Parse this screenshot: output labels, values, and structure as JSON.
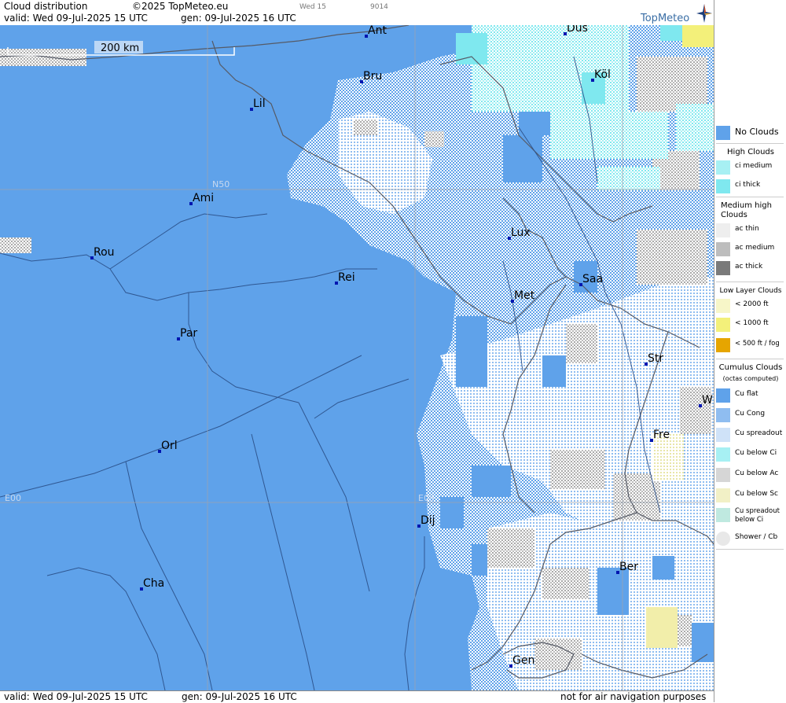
{
  "header": {
    "title": "Cloud distribution",
    "copyright": "©2025 TopMeteo.eu",
    "timestep": "Wed 15",
    "code": "9014",
    "valid": "valid:  Wed  09-Jul-2025  15 UTC",
    "generated": "gen: 09-Jul-2025 16 UTC",
    "logo": "TopMeteo"
  },
  "map": {
    "scale_label": "200 km",
    "grid_labels": {
      "lat_n50": "N50",
      "lon_e00": "E00",
      "lon_e05": "E05"
    },
    "cities": [
      {
        "id": "ant",
        "name": "Ant"
      },
      {
        "id": "dus",
        "name": "Düs"
      },
      {
        "id": "bru",
        "name": "Bru"
      },
      {
        "id": "kol",
        "name": "Köl"
      },
      {
        "id": "lil",
        "name": "Lil"
      },
      {
        "id": "ami",
        "name": "Ami"
      },
      {
        "id": "lux",
        "name": "Lux"
      },
      {
        "id": "rou",
        "name": "Rou"
      },
      {
        "id": "rei",
        "name": "Rei"
      },
      {
        "id": "saa",
        "name": "Saa"
      },
      {
        "id": "met",
        "name": "Met"
      },
      {
        "id": "par",
        "name": "Par"
      },
      {
        "id": "str",
        "name": "Str"
      },
      {
        "id": "w",
        "name": "W"
      },
      {
        "id": "fre",
        "name": "Fre"
      },
      {
        "id": "orl",
        "name": "Orl"
      },
      {
        "id": "dij",
        "name": "Dij"
      },
      {
        "id": "ber",
        "name": "Ber"
      },
      {
        "id": "cha",
        "name": "Cha"
      },
      {
        "id": "gen",
        "name": "Gen"
      }
    ]
  },
  "footer": {
    "valid": "valid:  Wed  09-Jul-2025  15 UTC",
    "generated": "gen: 09-Jul-2025 16 UTC",
    "disclaimer": "not for air navigation purposes"
  },
  "legend": {
    "no_clouds": "No Clouds",
    "high_clouds": "High Clouds",
    "ci_medium": "ci medium",
    "ci_thick": "ci thick",
    "medium_high": "Medium high Clouds",
    "ac_thin": "ac thin",
    "ac_medium": "ac medium",
    "ac_thick": "ac thick",
    "low_layer": "Low Layer Clouds",
    "lt2000": "< 2000 ft",
    "lt1000": "< 1000 ft",
    "lt500": "< 500 ft / fog",
    "cumulus": "Cumulus Clouds",
    "octas": "(octas computed)",
    "cu_flat": "Cu flat",
    "cu_cong": "Cu Cong",
    "cu_spreadout": "Cu spreadout",
    "cu_below_ci": "Cu below Ci",
    "cu_below_ac": "Cu below Ac",
    "cu_below_sc": "Cu below Sc",
    "cu_spreadout_below_ci": "Cu spreadout below Ci",
    "shower": "Shower / Cb"
  },
  "colors": {
    "no_clouds": "#5fa2ea",
    "cu_white": "#ffffff",
    "ac_gray": "#bdbdbd",
    "ci_cyan": "#7fe8ef",
    "low_yellow": "#f3f07a",
    "city_marker": "#0016b0",
    "border_line": "#555a66"
  }
}
